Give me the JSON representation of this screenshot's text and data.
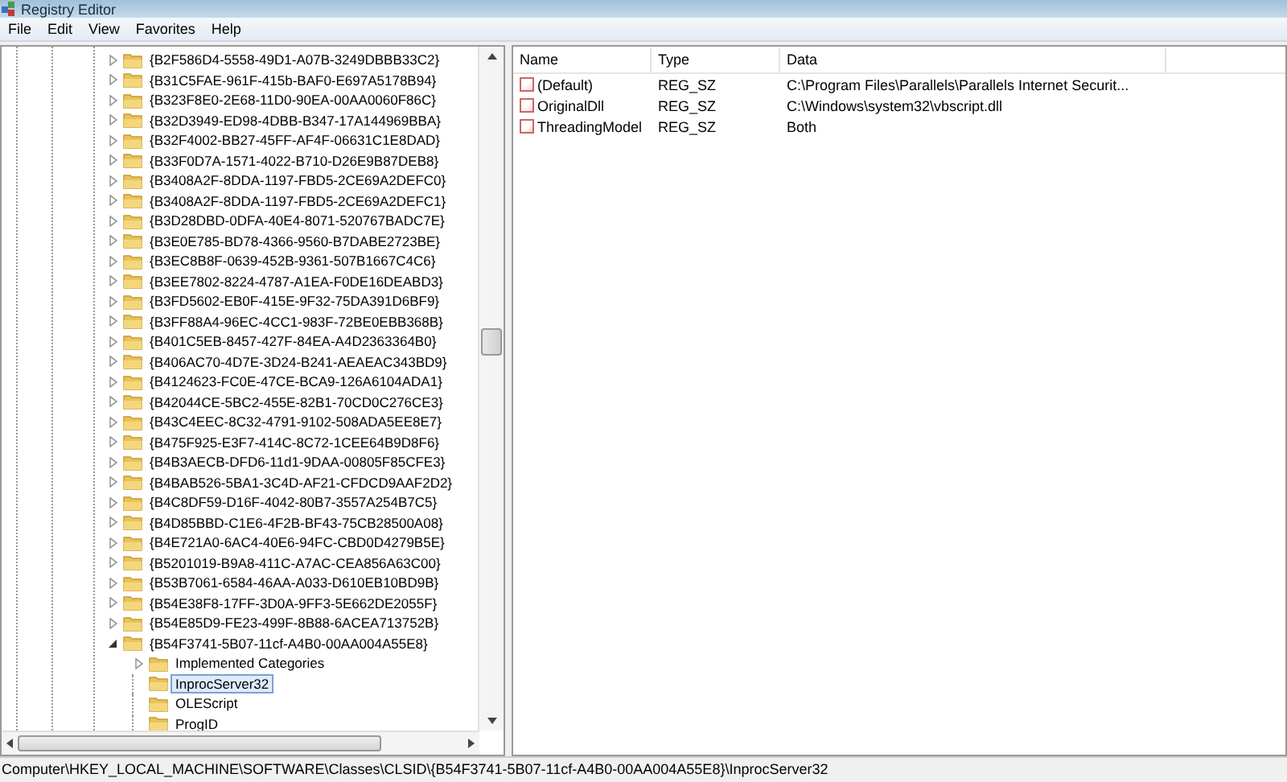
{
  "window": {
    "title": "Registry Editor"
  },
  "menu": [
    "File",
    "Edit",
    "View",
    "Favorites",
    "Help"
  ],
  "tree": [
    {
      "label": "{B2F586D4-5558-49D1-A07B-3249DBBB33C2}",
      "expandable": true,
      "expanded": false,
      "selected": false
    },
    {
      "label": "{B31C5FAE-961F-415b-BAF0-E697A5178B94}",
      "expandable": true,
      "expanded": false,
      "selected": false
    },
    {
      "label": "{B323F8E0-2E68-11D0-90EA-00AA0060F86C}",
      "expandable": true,
      "expanded": false,
      "selected": false
    },
    {
      "label": "{B32D3949-ED98-4DBB-B347-17A144969BBA}",
      "expandable": true,
      "expanded": false,
      "selected": false
    },
    {
      "label": "{B32F4002-BB27-45FF-AF4F-06631C1E8DAD}",
      "expandable": true,
      "expanded": false,
      "selected": false
    },
    {
      "label": "{B33F0D7A-1571-4022-B710-D26E9B87DEB8}",
      "expandable": true,
      "expanded": false,
      "selected": false
    },
    {
      "label": "{B3408A2F-8DDA-1197-FBD5-2CE69A2DEFC0}",
      "expandable": true,
      "expanded": false,
      "selected": false
    },
    {
      "label": "{B3408A2F-8DDA-1197-FBD5-2CE69A2DEFC1}",
      "expandable": true,
      "expanded": false,
      "selected": false
    },
    {
      "label": "{B3D28DBD-0DFA-40E4-8071-520767BADC7E}",
      "expandable": true,
      "expanded": false,
      "selected": false
    },
    {
      "label": "{B3E0E785-BD78-4366-9560-B7DABE2723BE}",
      "expandable": true,
      "expanded": false,
      "selected": false
    },
    {
      "label": "{B3EC8B8F-0639-452B-9361-507B1667C4C6}",
      "expandable": true,
      "expanded": false,
      "selected": false
    },
    {
      "label": "{B3EE7802-8224-4787-A1EA-F0DE16DEABD3}",
      "expandable": true,
      "expanded": false,
      "selected": false
    },
    {
      "label": "{B3FD5602-EB0F-415E-9F32-75DA391D6BF9}",
      "expandable": true,
      "expanded": false,
      "selected": false
    },
    {
      "label": "{B3FF88A4-96EC-4CC1-983F-72BE0EBB368B}",
      "expandable": true,
      "expanded": false,
      "selected": false
    },
    {
      "label": "{B401C5EB-8457-427F-84EA-A4D2363364B0}",
      "expandable": true,
      "expanded": false,
      "selected": false
    },
    {
      "label": "{B406AC70-4D7E-3D24-B241-AEAEAC343BD9}",
      "expandable": true,
      "expanded": false,
      "selected": false
    },
    {
      "label": "{B4124623-FC0E-47CE-BCA9-126A6104ADA1}",
      "expandable": true,
      "expanded": false,
      "selected": false
    },
    {
      "label": "{B42044CE-5BC2-455E-82B1-70CD0C276CE3}",
      "expandable": true,
      "expanded": false,
      "selected": false
    },
    {
      "label": "{B43C4EEC-8C32-4791-9102-508ADA5EE8E7}",
      "expandable": true,
      "expanded": false,
      "selected": false
    },
    {
      "label": "{B475F925-E3F7-414C-8C72-1CEE64B9D8F6}",
      "expandable": true,
      "expanded": false,
      "selected": false
    },
    {
      "label": "{B4B3AECB-DFD6-11d1-9DAA-00805F85CFE3}",
      "expandable": true,
      "expanded": false,
      "selected": false
    },
    {
      "label": "{B4BAB526-5BA1-3C4D-AF21-CFDCD9AAF2D2}",
      "expandable": true,
      "expanded": false,
      "selected": false
    },
    {
      "label": "{B4C8DF59-D16F-4042-80B7-3557A254B7C5}",
      "expandable": true,
      "expanded": false,
      "selected": false
    },
    {
      "label": "{B4D85BBD-C1E6-4F2B-BF43-75CB28500A08}",
      "expandable": true,
      "expanded": false,
      "selected": false
    },
    {
      "label": "{B4E721A0-6AC4-40E6-94FC-CBD0D4279B5E}",
      "expandable": true,
      "expanded": false,
      "selected": false
    },
    {
      "label": "{B5201019-B9A8-411C-A7AC-CEA856A63C00}",
      "expandable": true,
      "expanded": false,
      "selected": false
    },
    {
      "label": "{B53B7061-6584-46AA-A033-D610EB10BD9B}",
      "expandable": true,
      "expanded": false,
      "selected": false
    },
    {
      "label": "{B54E38F8-17FF-3D0A-9FF3-5E662DE2055F}",
      "expandable": true,
      "expanded": false,
      "selected": false
    },
    {
      "label": "{B54E85D9-FE23-499F-8B88-6ACEA713752B}",
      "expandable": true,
      "expanded": false,
      "selected": false
    },
    {
      "label": "{B54F3741-5B07-11cf-A4B0-00AA004A55E8}",
      "expandable": true,
      "expanded": true,
      "selected": false,
      "children": [
        {
          "label": "Implemented Categories",
          "expandable": true,
          "expanded": false,
          "selected": false
        },
        {
          "label": "InprocServer32",
          "expandable": false,
          "selected": true
        },
        {
          "label": "OLEScript",
          "expandable": false,
          "selected": false
        },
        {
          "label": "ProgID",
          "expandable": false,
          "selected": false
        }
      ]
    }
  ],
  "values": {
    "columns": [
      "Name",
      "Type",
      "Data"
    ],
    "rows": [
      {
        "name": "(Default)",
        "type": "REG_SZ",
        "data": "C:\\Program Files\\Parallels\\Parallels Internet Securit..."
      },
      {
        "name": "OriginalDll",
        "type": "REG_SZ",
        "data": "C:\\Windows\\system32\\vbscript.dll"
      },
      {
        "name": "ThreadingModel",
        "type": "REG_SZ",
        "data": "Both"
      }
    ]
  },
  "status_bar": "Computer\\HKEY_LOCAL_MACHINE\\SOFTWARE\\Classes\\CLSID\\{B54F3741-5B07-11cf-A4B0-00AA004A55E8}\\InprocServer32"
}
